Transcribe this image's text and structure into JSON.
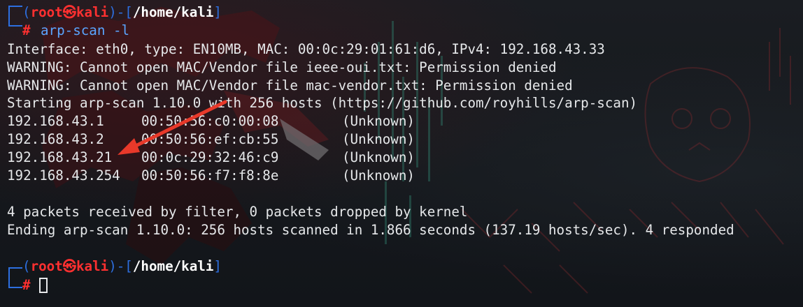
{
  "colors": {
    "background": "#15181c",
    "prompt_frame": "#2d6fe0",
    "prompt_user": "#ff3030",
    "prompt_cwd": "#ffffff",
    "command_text": "#5aa5ff",
    "output_text": "#e6e8ea",
    "annotation_arrow": "#e8392a"
  },
  "prompt1": {
    "open_paren": "(",
    "user": "root",
    "symbol": "㉿",
    "host": "kali",
    "close_paren": ")",
    "dash": "-[",
    "cwd": "/home/kali",
    "close_bracket": "]",
    "hash": "#",
    "command": "arp-scan -l"
  },
  "output": {
    "interface_line": "Interface: eth0, type: EN10MB, MAC: 00:0c:29:01:61:d6, IPv4: 192.168.43.33",
    "warning1": "WARNING: Cannot open MAC/Vendor file ieee-oui.txt: Permission denied",
    "warning2": "WARNING: Cannot open MAC/Vendor file mac-vendor.txt: Permission denied",
    "starting": "Starting arp-scan 1.10.0 with 256 hosts (https://github.com/royhills/arp-scan)",
    "hosts": [
      {
        "ip": "192.168.43.1",
        "mac": "00:50:56:c0:00:08",
        "vendor": "(Unknown)"
      },
      {
        "ip": "192.168.43.2",
        "mac": "00:50:56:ef:cb:55",
        "vendor": "(Unknown)"
      },
      {
        "ip": "192.168.43.21",
        "mac": "00:0c:29:32:46:c9",
        "vendor": "(Unknown)"
      },
      {
        "ip": "192.168.43.254",
        "mac": "00:50:56:f7:f8:8e",
        "vendor": "(Unknown)"
      }
    ],
    "packets_line": "4 packets received by filter, 0 packets dropped by kernel",
    "ending_line": "Ending arp-scan 1.10.0: 256 hosts scanned in 1.866 seconds (137.19 hosts/sec). 4 responded"
  },
  "prompt2": {
    "open_paren": "(",
    "user": "root",
    "symbol": "㉿",
    "host": "kali",
    "close_paren": ")",
    "dash": "-[",
    "cwd": "/home/kali",
    "close_bracket": "]",
    "hash": "#"
  }
}
